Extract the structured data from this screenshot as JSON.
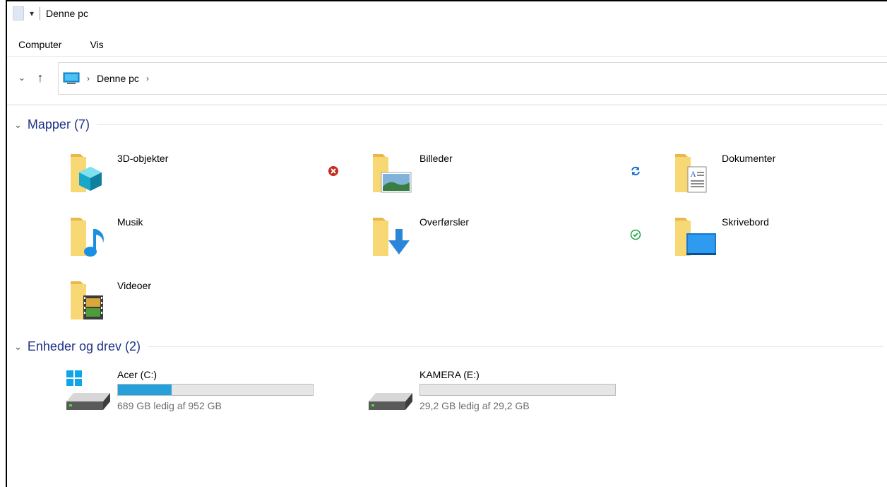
{
  "window": {
    "title": "Denne pc"
  },
  "ribbon": {
    "tabs": [
      "Computer",
      "Vis"
    ]
  },
  "address": {
    "crumbs": [
      "Denne pc"
    ]
  },
  "groups": {
    "folders": {
      "header": "Mapper (7)"
    },
    "drives": {
      "header": "Enheder og drev (2)"
    }
  },
  "folders": [
    {
      "label": "3D-objekter",
      "icon": "folder-3d-objects-icon"
    },
    {
      "label": "Billeder",
      "icon": "folder-pictures-icon"
    },
    {
      "label": "Dokumenter",
      "icon": "folder-documents-icon"
    },
    {
      "label": "Musik",
      "icon": "folder-music-icon"
    },
    {
      "label": "Overførsler",
      "icon": "folder-downloads-icon"
    },
    {
      "label": "Skrivebord",
      "icon": "folder-desktop-icon"
    },
    {
      "label": "Videoer",
      "icon": "folder-videos-icon"
    }
  ],
  "status_icons": [
    {
      "name": "error-status-icon",
      "color": "#c42b1c"
    },
    {
      "name": "sync-status-icon",
      "color": "#1f6fd0"
    },
    {
      "name": "synced-status-icon",
      "color": "#17a23a"
    }
  ],
  "drives": [
    {
      "name": "Acer (C:)",
      "free": "689 GB ledig af 952 GB",
      "used_fraction": 0.276,
      "bar_color": "#26a0da"
    },
    {
      "name": "KAMERA (E:)",
      "free": "29,2 GB ledig af 29,2 GB",
      "used_fraction": 0.0,
      "bar_color": "#26a0da"
    }
  ]
}
